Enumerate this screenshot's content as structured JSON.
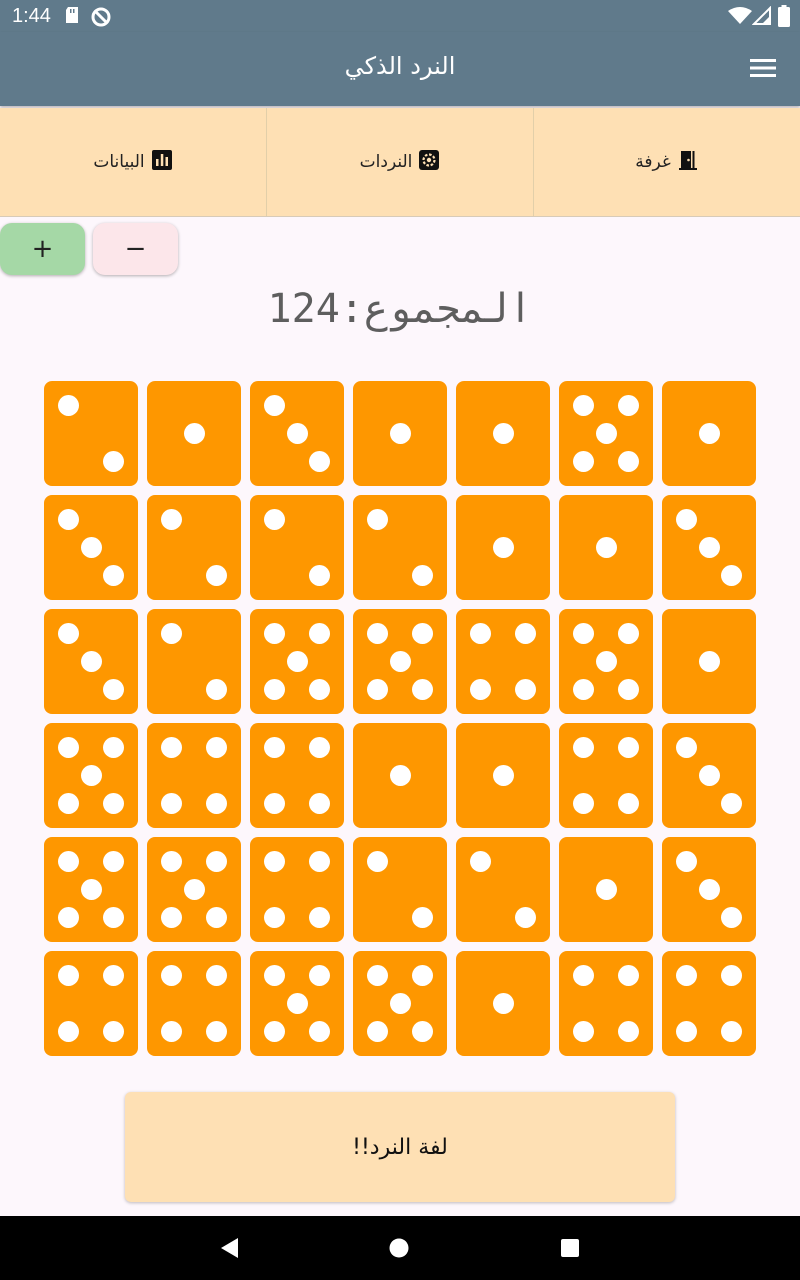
{
  "status_bar": {
    "time": "1:44",
    "icons": [
      "sd-card-icon",
      "vpn-icon",
      "wifi-icon",
      "signal-icon",
      "battery-icon"
    ]
  },
  "app_bar": {
    "title": "النرد الذكي",
    "menu_icon": "menu-icon"
  },
  "tabs": [
    {
      "label": "غرفة",
      "icon": "door-icon"
    },
    {
      "label": "النردات",
      "icon": "settings-icon"
    },
    {
      "label": "البيانات",
      "icon": "bar-chart-icon"
    }
  ],
  "controls": {
    "plus_label": "+",
    "minus_label": "−"
  },
  "total": {
    "text": "المجموع:124"
  },
  "dice": [
    [
      2,
      1,
      3,
      1,
      1,
      5,
      1
    ],
    [
      3,
      2,
      2,
      2,
      1,
      1,
      3
    ],
    [
      3,
      2,
      5,
      5,
      4,
      5,
      1
    ],
    [
      5,
      4,
      4,
      1,
      1,
      4,
      3
    ],
    [
      5,
      5,
      4,
      2,
      2,
      1,
      3
    ],
    [
      4,
      4,
      5,
      5,
      1,
      4,
      4
    ]
  ],
  "roll_button": {
    "label": "لفة النرد!!"
  },
  "colors": {
    "app_bar": "#607a8b",
    "tab_bar": "#fee0b4",
    "die": "#fe9700",
    "pip": "#ffffff",
    "plus_button": "#a5d8a6",
    "minus_button": "#fce6ea",
    "background": "#fdf7fc"
  }
}
